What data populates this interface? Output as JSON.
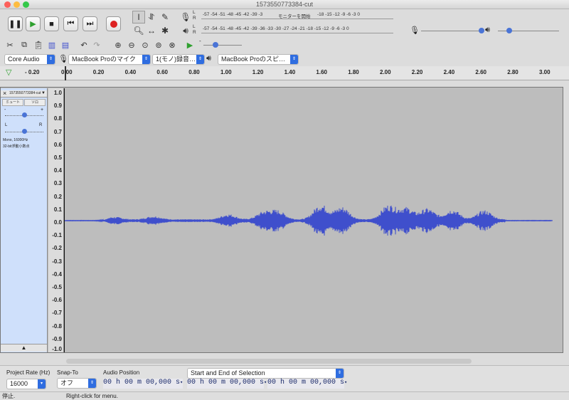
{
  "window": {
    "title": "1573550773384-cut"
  },
  "transport": {
    "pause": "pause",
    "play": "play",
    "stop": "stop",
    "skip_start": "skip-start",
    "skip_end": "skip-end",
    "record": "record"
  },
  "meters": {
    "rec_label_L": "L",
    "rec_label_R": "R",
    "play_label_L": "L",
    "play_label_R": "R",
    "rec_scale": "-57 -54 -51 -48 -45 -42 -39 -3",
    "rec_monitor": "モニターを開始",
    "rec_scale_tail": "-18 -15 -12 -9 -6 -3 0",
    "play_scale": "-57 -54 -51 -48 -45 -42 -39 -36 -33 -30 -27 -24 -21 -18 -15 -12 -9 -6 -3 0"
  },
  "devices": {
    "host": "Core Audio",
    "rec_device": "MacBook Proのマイク",
    "channels": "1(モノ)録音…",
    "play_device": "MacBook Proのスピ…"
  },
  "ruler": {
    "ticks": [
      "- 0.20",
      "0.00",
      "0.20",
      "0.40",
      "0.60",
      "0.80",
      "1.00",
      "1.20",
      "1.40",
      "1.60",
      "1.80",
      "2.00",
      "2.20",
      "2.40",
      "2.60",
      "2.80",
      "3.00"
    ]
  },
  "track": {
    "name": "1573550773384-cut",
    "mute": "ミュート",
    "solo": "ソロ",
    "gain_minus": "-",
    "gain_plus": "+",
    "pan_left": "L",
    "pan_right": "R",
    "info_line1": "Mono, 16000Hz",
    "info_line2": "32-bit浮動小数点"
  },
  "vscale": [
    "1.0",
    "0.9",
    "0.8",
    "0.7",
    "0.6",
    "0.5",
    "0.4",
    "0.3",
    "0.2",
    "0.1",
    "0.0",
    "-0.1",
    "-0.2",
    "-0.3",
    "-0.4",
    "-0.5",
    "-0.6",
    "-0.7",
    "-0.8",
    "-0.9",
    "-1.0"
  ],
  "bottom": {
    "rate_label": "Project Rate (Hz)",
    "rate_value": "16000",
    "snap_label": "Snap-To",
    "snap_value": "オフ",
    "audio_pos_label": "Audio Position",
    "audio_pos_value": "00 h 00 m 00,000 s",
    "selection_mode": "Start and End of Selection",
    "sel_start": "00 h 00 m 00,000 s",
    "sel_end": "00 h 00 m 00,000 s"
  },
  "status": {
    "left": "停止.",
    "right": "Right-click for menu."
  },
  "colors": {
    "waveform": "#3f4fcc",
    "accent": "#2f6de0",
    "record": "#d22"
  }
}
